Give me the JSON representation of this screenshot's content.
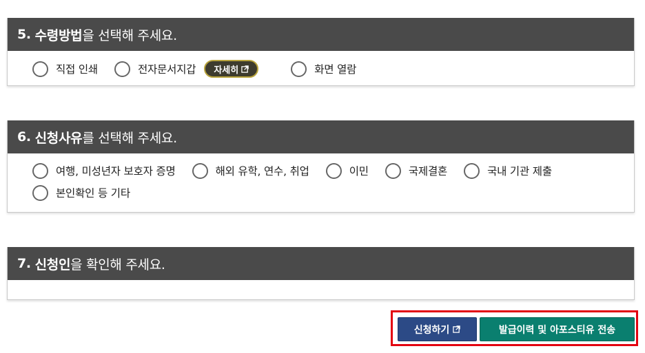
{
  "section5": {
    "num": "5.",
    "title_bold": "수령방법",
    "title_rest": "을 선택해 주세요.",
    "options": [
      "직접 인쇄",
      "전자문서지갑",
      "화면 열람"
    ],
    "detail_button": "자세히"
  },
  "section6": {
    "num": "6.",
    "title_bold": "신청사유",
    "title_rest": "를 선택해 주세요.",
    "options": [
      "여행, 미성년자 보호자 증명",
      "해외 유학, 연수, 취업",
      "이민",
      "국제결혼",
      "국내 기관 제출",
      "본인확인 등 기타"
    ]
  },
  "section7": {
    "num": "7.",
    "title_bold": "신청인",
    "title_rest": "을 확인해 주세요."
  },
  "actions": {
    "apply_label": "신청하기",
    "send_label": "발급이력 및 아포스티유 전송"
  }
}
